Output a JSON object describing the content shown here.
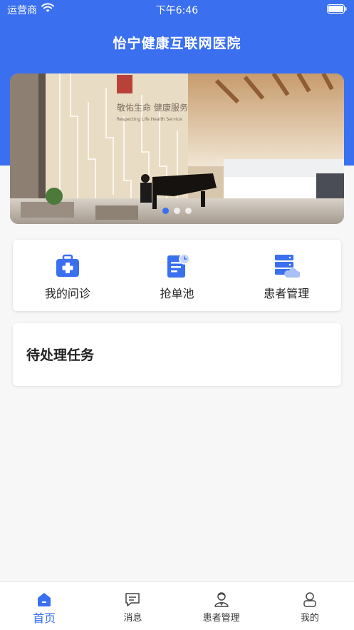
{
  "status_bar": {
    "carrier": "运营商",
    "time": "下午6:46"
  },
  "header": {
    "title": "怡宁健康互联网医院"
  },
  "banner": {
    "sign_text": "敬佑生命 健康服务",
    "sign_subtext": "Respecting Life Health Service",
    "dots_count": 3,
    "active_dot": 0
  },
  "quick_actions": [
    {
      "label": "我的问诊",
      "icon": "medical-kit-icon"
    },
    {
      "label": "抢单池",
      "icon": "clipboard-clock-icon"
    },
    {
      "label": "患者管理",
      "icon": "server-cloud-icon"
    }
  ],
  "tasks": {
    "title": "待处理任务"
  },
  "tabbar": [
    {
      "label": "首页",
      "icon": "home-icon",
      "active": true
    },
    {
      "label": "消息",
      "icon": "message-icon",
      "active": false
    },
    {
      "label": "患者管理",
      "icon": "doctor-icon",
      "active": false
    },
    {
      "label": "我的",
      "icon": "user-icon",
      "active": false
    }
  ],
  "colors": {
    "primary": "#3a6ff0",
    "background": "#f7f7f8",
    "card": "#ffffff"
  }
}
